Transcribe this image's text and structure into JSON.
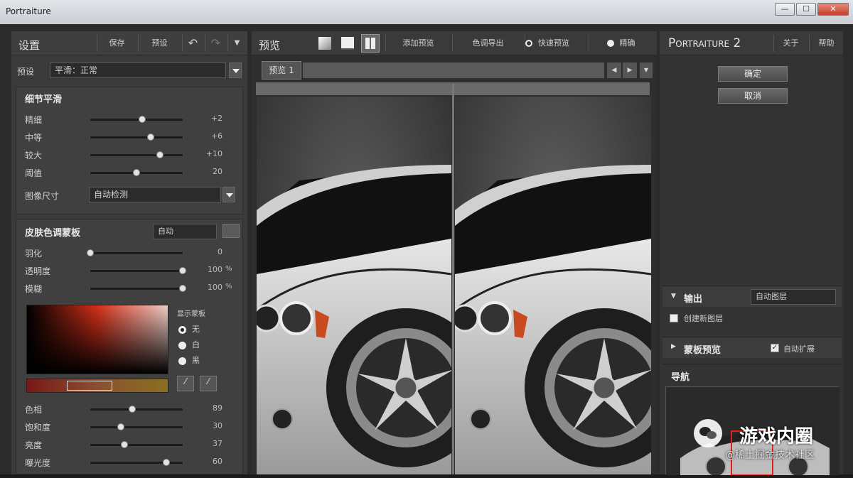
{
  "window": {
    "title": "Portraiture",
    "minimize": "—",
    "maximize": "☐",
    "close": "✕"
  },
  "left": {
    "header": {
      "title": "设置",
      "save": "保存",
      "preset": "预设",
      "undo": "↶",
      "redo": "↷",
      "menu": "▼"
    },
    "preset_row": {
      "label": "预设",
      "value": "平滑：正常"
    },
    "detail": {
      "title": "细节平滑",
      "sliders": [
        {
          "label": "精细",
          "value": "+2",
          "pos": 0.56
        },
        {
          "label": "中等",
          "value": "+6",
          "pos": 0.65
        },
        {
          "label": "较大",
          "value": "+10",
          "pos": 0.75
        },
        {
          "label": "阈值",
          "value": "20",
          "pos": 0.5
        }
      ],
      "image_size_label": "图像尺寸",
      "image_size_value": "自动检测"
    },
    "skin": {
      "title": "皮肤色调蒙板",
      "mode": "自动",
      "sliders": [
        {
          "label": "羽化",
          "value": "0",
          "pos": 0.0,
          "pct": ""
        },
        {
          "label": "透明度",
          "value": "100",
          "pos": 1.0,
          "pct": "%"
        },
        {
          "label": "模糊",
          "value": "100",
          "pos": 1.0,
          "pct": "%"
        }
      ],
      "mask_label": "显示蒙板",
      "mask_options": [
        "无",
        "白",
        "黑"
      ],
      "mask_selected": 0,
      "sliders2": [
        {
          "label": "色相",
          "value": "89",
          "pos": 0.45
        },
        {
          "label": "饱和度",
          "value": "30",
          "pos": 0.33
        },
        {
          "label": "亮度",
          "value": "37",
          "pos": 0.37
        },
        {
          "label": "曝光度",
          "value": "60",
          "pos": 0.82
        }
      ]
    }
  },
  "center": {
    "header": {
      "title": "预览",
      "add_preview": "添加预览",
      "color_pick": "色调导出",
      "fast_preview": "快速预览",
      "accurate": "精确"
    },
    "tab": "预览 1",
    "nav": {
      "prev": "◀",
      "next": "▶",
      "more": "▼"
    }
  },
  "right": {
    "brand": "Portraiture 2",
    "about": "关于",
    "help": "帮助",
    "ok": "确定",
    "cancel": "取消",
    "output": {
      "label": "输出",
      "value": "自动图层"
    },
    "create_new_layer": "创建新图层",
    "mask_preview": {
      "label": "蒙板预览",
      "auto_expand": "自动扩展"
    },
    "navigator": "导航"
  },
  "watermark": {
    "text1": "游戏内圈",
    "text2": "@稀土掘金技术社区"
  },
  "colors": {
    "accent": "#e0e0e0",
    "panel": "#3a3a3a",
    "hue_red": "#d03a1a"
  }
}
